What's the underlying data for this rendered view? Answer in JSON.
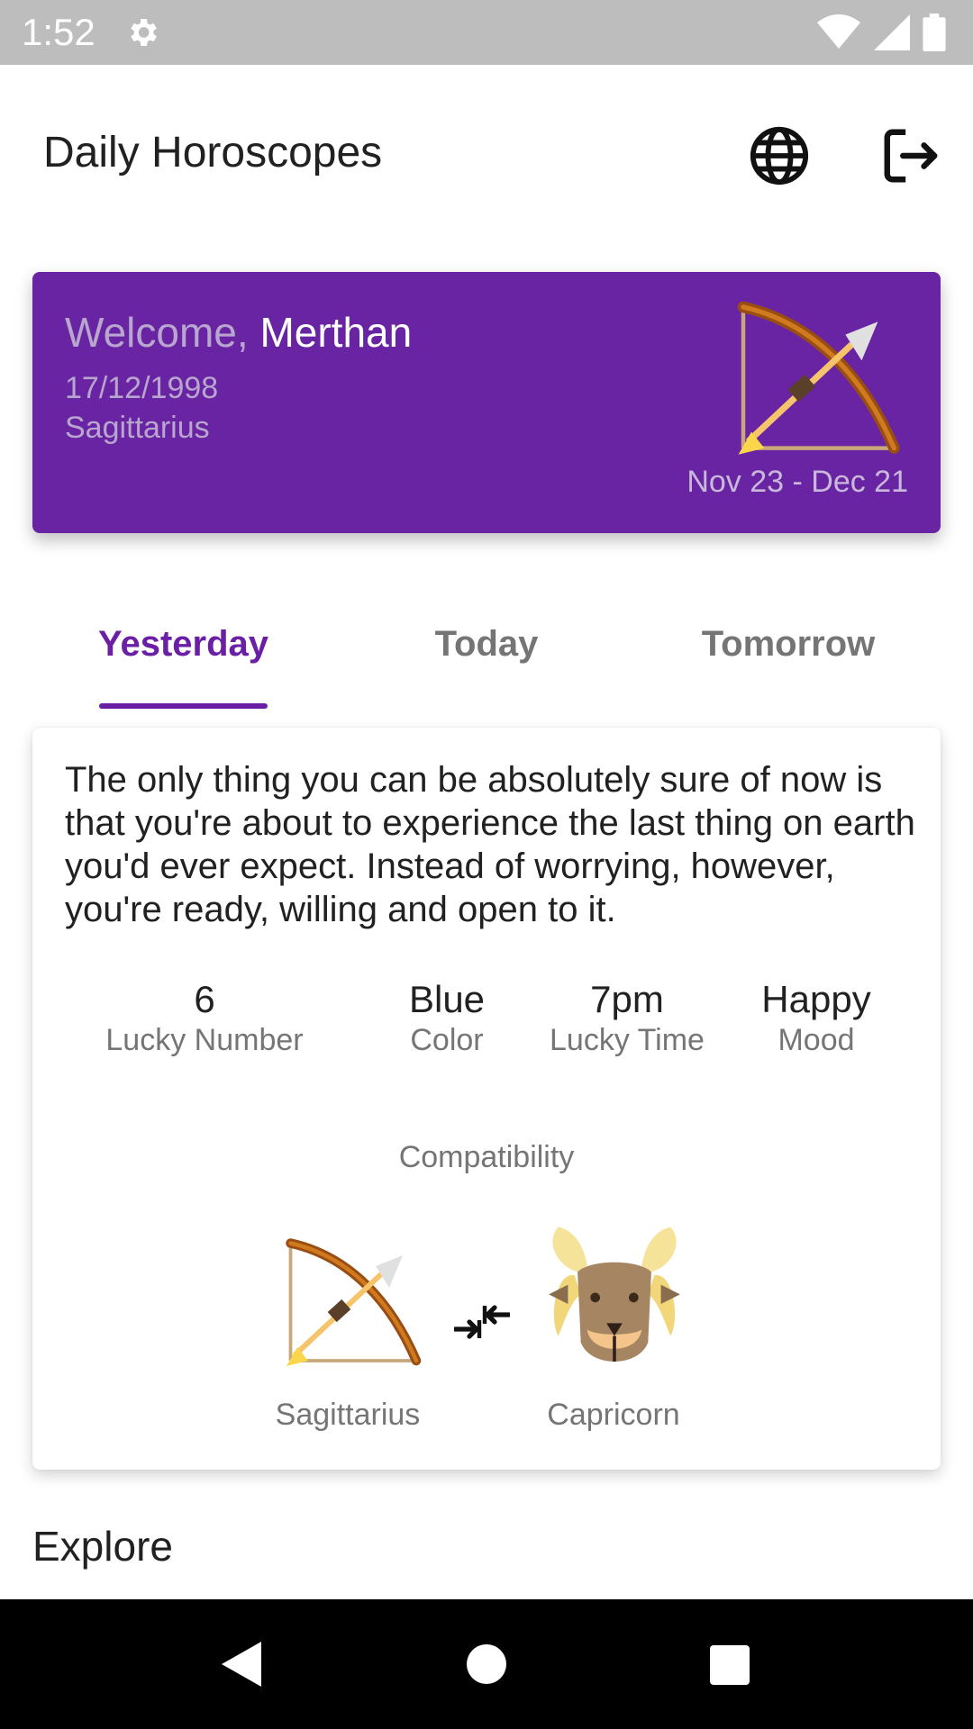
{
  "status_bar": {
    "time": "1:52",
    "icons": [
      "gear-icon",
      "wifi-icon",
      "signal-icon",
      "battery-icon"
    ]
  },
  "app_bar": {
    "title": "Daily Horoscopes",
    "actions": [
      "globe-icon",
      "logout-icon"
    ]
  },
  "welcome_card": {
    "greeting_prefix": "Welcome,",
    "user_name": "Merthan",
    "birth_date": "17/12/1998",
    "sign": "Sagittarius",
    "date_range": "Nov 23 - Dec 21",
    "sign_icon": "sagittarius-bow-icon",
    "background_color": "#6824a2"
  },
  "tabs": [
    {
      "label": "Yesterday",
      "active": true
    },
    {
      "label": "Today",
      "active": false
    },
    {
      "label": "Tomorrow",
      "active": false
    }
  ],
  "reading": {
    "text": "The only thing you can be absolutely sure of now is that you're about to experience the last thing on earth you'd ever expect. Instead of worrying, however, you're ready, willing and open to it.",
    "stats": [
      {
        "value": "6",
        "label": "Lucky Number"
      },
      {
        "value": "Blue",
        "label": "Color"
      },
      {
        "value": "7pm",
        "label": "Lucky Time"
      },
      {
        "value": "Happy",
        "label": "Mood"
      }
    ],
    "compatibility": {
      "title": "Compatibility",
      "sign_a": "Sagittarius",
      "sign_b": "Capricorn",
      "icon_a": "sagittarius-bow-icon",
      "icon_b": "capricorn-ram-icon",
      "connector_icon": "compare-arrows-icon"
    }
  },
  "explore": {
    "title": "Explore"
  },
  "nav_bar": {
    "icons": [
      "back-icon",
      "home-icon",
      "recents-icon"
    ]
  },
  "colors": {
    "accent": "#6a1fa5",
    "muted_text": "#757575"
  }
}
